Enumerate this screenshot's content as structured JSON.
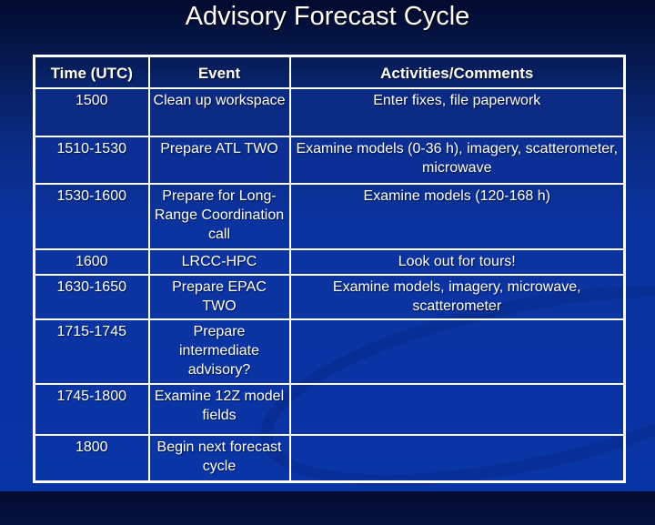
{
  "slide": {
    "title": "Advisory Forecast Cycle",
    "background_color": "#0b33a0",
    "border_color": "#ffffff"
  },
  "table": {
    "headers": [
      "Time (UTC)",
      "Event",
      "Activities/Comments"
    ],
    "rows": [
      {
        "time": "1500",
        "event": "Clean up workspace",
        "comment": "Enter fixes, file paperwork"
      },
      {
        "time": "1510-1530",
        "event": "Prepare ATL TWO",
        "comment": "Examine models (0-36 h), imagery, scatterometer, microwave"
      },
      {
        "time": "1530-1600",
        "event": "Prepare for Long-Range Coordination call",
        "comment": "Examine models (120-168 h)"
      },
      {
        "time": "1600",
        "event": "LRCC-HPC",
        "comment": "Look out for tours!"
      },
      {
        "time": "1630-1650",
        "event": "Prepare EPAC TWO",
        "comment": "Examine models, imagery, microwave, scatterometer"
      },
      {
        "time": "1715-1745",
        "event": "Prepare intermediate advisory?",
        "comment": ""
      },
      {
        "time": "1745-1800",
        "event": "Examine 12Z model fields",
        "comment": ""
      },
      {
        "time": "1800",
        "event": "Begin next forecast cycle",
        "comment": ""
      }
    ]
  }
}
